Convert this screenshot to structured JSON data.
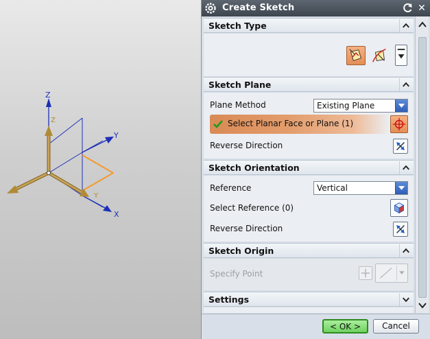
{
  "viewport": {
    "axes": {
      "z": "Z",
      "y": "Y",
      "x": "X"
    },
    "small_axes": {
      "z": "Z",
      "y": "Y"
    }
  },
  "dialog": {
    "title": "Create Sketch",
    "icons": {
      "title": "gear-icon",
      "reset": "reset-icon",
      "close": "close-icon"
    },
    "close_glyph": "✕"
  },
  "sketch_type": {
    "title": "Sketch Type",
    "buttons": [
      "on-plane-sketch-icon",
      "on-path-sketch-icon",
      "type-dropdown-icon"
    ]
  },
  "sketch_plane": {
    "title": "Sketch Plane",
    "plane_method_label": "Plane Method",
    "plane_method_value": "Existing Plane",
    "select_face_label": "Select Planar Face or Plane (1)",
    "reverse_direction_label": "Reverse Direction"
  },
  "sketch_orientation": {
    "title": "Sketch Orientation",
    "reference_label": "Reference",
    "reference_value": "Vertical",
    "select_reference_label": "Select Reference (0)",
    "reverse_direction_label": "Reverse Direction"
  },
  "sketch_origin": {
    "title": "Sketch Origin",
    "specify_point_label": "Specify Point"
  },
  "settings": {
    "title": "Settings"
  },
  "footer": {
    "ok_label": "< OK >",
    "cancel_label": "Cancel"
  },
  "colors": {
    "titlebar": "#4a525b",
    "highlight": "#e39d6d",
    "ok": "#6fd25f",
    "axis_blue": "#1c2fb8",
    "axis_tan": "#b08a34",
    "orange_line": "#f39a2e"
  }
}
